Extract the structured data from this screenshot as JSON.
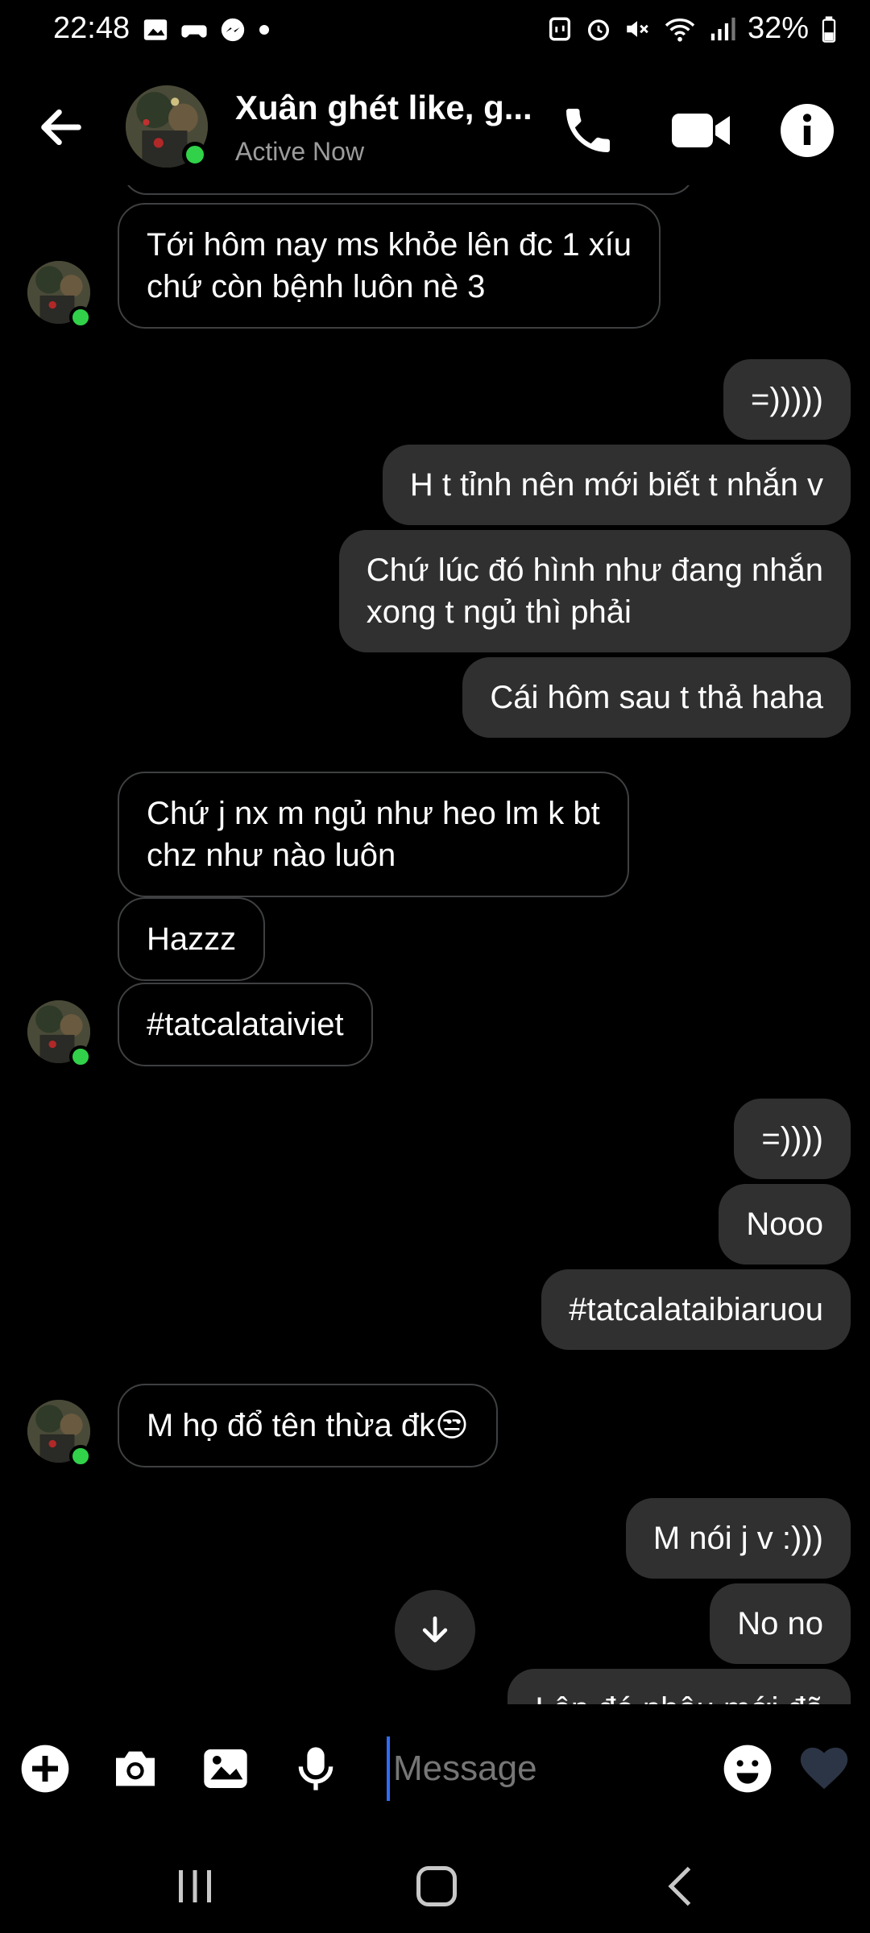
{
  "status": {
    "time": "22:48",
    "battery": "32%",
    "icons": [
      "image-icon",
      "game-controller-icon",
      "messenger-icon",
      "dot-icon",
      "nfc-icon",
      "alarm-icon",
      "mute-icon",
      "wifi-icon",
      "signal-icon",
      "battery-icon"
    ]
  },
  "header": {
    "name": "Xuân ghét like, g...",
    "status": "Active Now"
  },
  "messages": [
    {
      "side": "in",
      "lines": [
        "Tới hôm nay ms khỏe lên đc 1 xíu",
        "chứ còn bệnh luôn nè 3"
      ]
    },
    {
      "side": "out",
      "lines": [
        "=)))))"
      ]
    },
    {
      "side": "out",
      "lines": [
        "H t tỉnh nên mới biết t nhắn v"
      ]
    },
    {
      "side": "out",
      "lines": [
        "Chứ lúc đó hình như đang nhắn",
        "xong t ngủ thì phải"
      ]
    },
    {
      "side": "out",
      "lines": [
        "Cái hôm sau t thả haha"
      ]
    },
    {
      "side": "in",
      "lines": [
        "Chứ j nx m ngủ như heo lm k bt",
        "chz như nào luôn"
      ]
    },
    {
      "side": "in",
      "lines": [
        "Hazzz"
      ]
    },
    {
      "side": "in",
      "lines": [
        "#tatcalataiviet"
      ]
    },
    {
      "side": "out",
      "lines": [
        "=))))"
      ]
    },
    {
      "side": "out",
      "lines": [
        "Nooo"
      ]
    },
    {
      "side": "out",
      "lines": [
        "#tatcalataibiaruou"
      ]
    },
    {
      "side": "in",
      "lines": [
        "M họ đổ tên thừa đk😒"
      ]
    },
    {
      "side": "out",
      "lines": [
        "M nói j v :)))"
      ]
    },
    {
      "side": "out",
      "lines": [
        "No no"
      ]
    },
    {
      "side": "out",
      "lines": [
        "Lên đó nhậu mới đã"
      ]
    }
  ],
  "composer": {
    "placeholder": "Message"
  }
}
